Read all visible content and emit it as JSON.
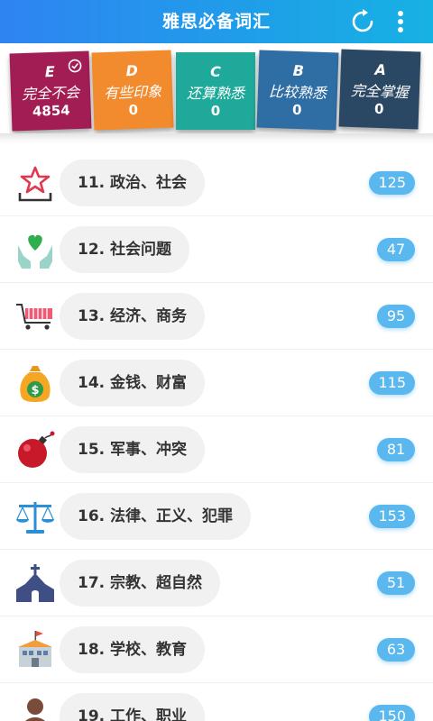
{
  "header": {
    "title": "雅思必备词汇",
    "refresh_icon": "refresh-icon",
    "more_icon": "more-vertical-icon"
  },
  "levels": [
    {
      "letter": "E",
      "name": "完全不会",
      "count": "4854",
      "color": "#a31d55",
      "icon": "check-circle-icon"
    },
    {
      "letter": "D",
      "name": "有些印象",
      "count": "0",
      "color": "#f28a2e"
    },
    {
      "letter": "C",
      "name": "还算熟悉",
      "count": "0",
      "color": "#1fa99a"
    },
    {
      "letter": "B",
      "name": "比较熟悉",
      "count": "0",
      "color": "#2f6da5"
    },
    {
      "letter": "A",
      "name": "完全掌握",
      "count": "0",
      "color": "#2a4763"
    }
  ],
  "categories": [
    {
      "label": "11. 政治、社会",
      "count": "125",
      "icon": "politics-star-icon"
    },
    {
      "label": "12. 社会问题",
      "count": "47",
      "icon": "heart-hands-icon"
    },
    {
      "label": "13. 经济、商务",
      "count": "95",
      "icon": "shopping-cart-icon"
    },
    {
      "label": "14. 金钱、财富",
      "count": "115",
      "icon": "money-bag-icon"
    },
    {
      "label": "15. 军事、冲突",
      "count": "81",
      "icon": "bomb-icon"
    },
    {
      "label": "16. 法律、正义、犯罪",
      "count": "153",
      "icon": "scales-icon"
    },
    {
      "label": "17. 宗教、超自然",
      "count": "51",
      "icon": "church-icon"
    },
    {
      "label": "18. 学校、教育",
      "count": "63",
      "icon": "school-icon"
    },
    {
      "label": "19. 工作、职业",
      "count": "150",
      "icon": "worker-icon"
    }
  ]
}
